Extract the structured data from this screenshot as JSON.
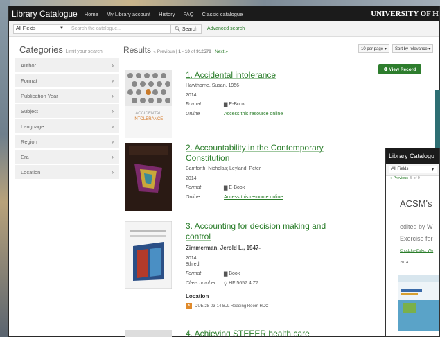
{
  "nav": {
    "brand": "Library Catalogue",
    "links": [
      "Home",
      "My Library account",
      "History",
      "FAQ",
      "Classic catalogue"
    ],
    "university": "UNIVERSITY OF Hul"
  },
  "search": {
    "field": "All Fields",
    "placeholder": "Search the catalogue...",
    "button": "Search",
    "advanced": "Advanced search"
  },
  "sidebar": {
    "title": "Categories",
    "subtitle": "Limit your search",
    "items": [
      "Author",
      "Format",
      "Publication Year",
      "Subject",
      "Language",
      "Region",
      "Era",
      "Location"
    ]
  },
  "results_header": {
    "title": "Results",
    "prev": "« Previous",
    "range": "1 - 10",
    "of": "of",
    "total": "912578",
    "next": "Next »",
    "per_page": "10 per page",
    "sort": "Sort by relevance"
  },
  "view_record": "View Record",
  "results": [
    {
      "title": "1. Accidental intolerance",
      "author": "Hawthorne, Susan, 1956-",
      "year": "2014",
      "format_label": "Format",
      "format": "E-Book",
      "online_label": "Online",
      "online": "Access this resource online",
      "cover_text": "ACCIDENTAL INTOLERANCE"
    },
    {
      "title": "2. Accountability in the Contemporary Constitution",
      "author": "Bamforth, Nicholas; Leyland, Peter",
      "year": "2014",
      "format_label": "Format",
      "format": "E-Book",
      "online_label": "Online",
      "online": "Access this resource online"
    },
    {
      "title": "3. Accounting for decision making and control",
      "author": "Zimmerman, Jerold L., 1947-",
      "year": "2014",
      "edition": "8th ed",
      "format_label": "Format",
      "format": "Book",
      "class_label": "Class number",
      "class_number": "HF 5657.4 Z7",
      "location_label": "Location",
      "location": "DUE 28-03-14  BJL Reading Room HDC"
    },
    {
      "title": "4. Achieving STEEER health care"
    }
  ],
  "overlay": {
    "brand": "Library Catalogu",
    "field": "All Fields",
    "prev": "« Previous",
    "position": "5 of 9",
    "title": "ACSM's",
    "editor": "edited by W",
    "subtitle": "Exercise for",
    "authors": "Chodzko-Zajko, Wo",
    "year": "2014"
  },
  "colors": {
    "accent_green": "#2a7d2a",
    "nav_bg": "#1b1b1b",
    "button_green": "#2d7d2d"
  }
}
